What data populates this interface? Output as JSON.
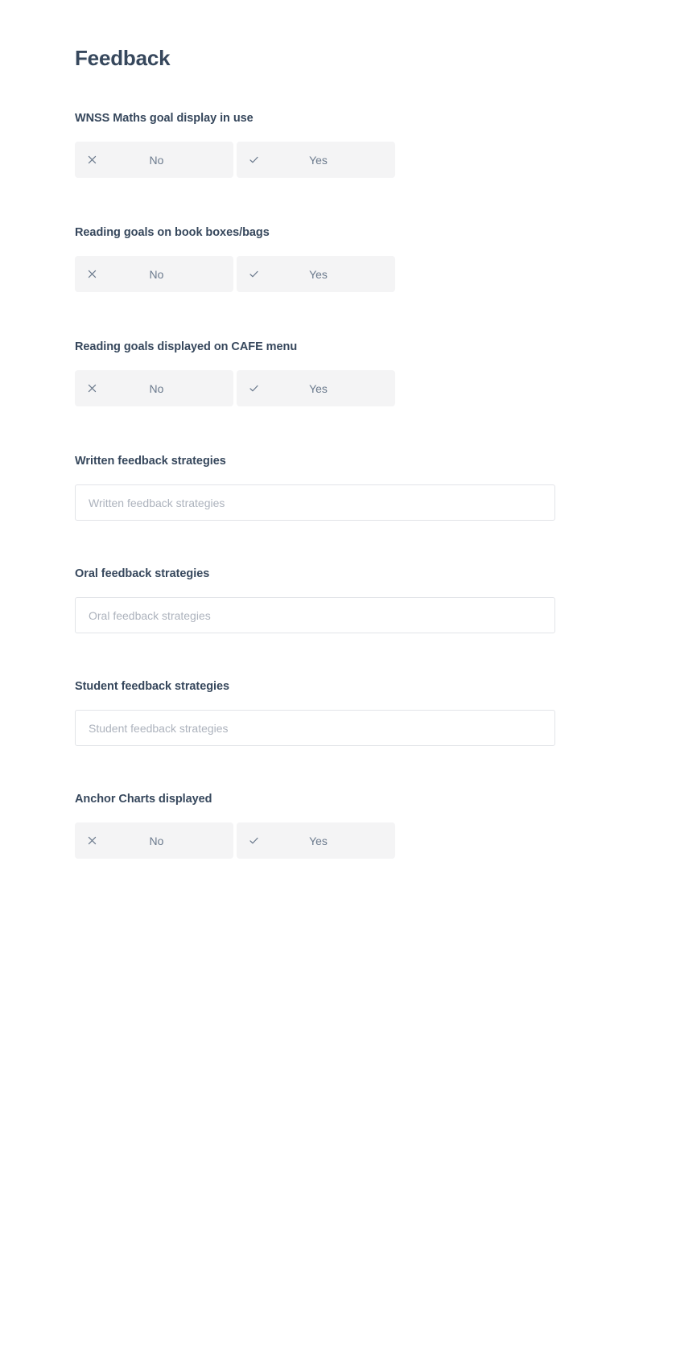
{
  "page": {
    "title": "Feedback",
    "background_color": "#ffffff",
    "heading_color": "#36475c",
    "toggle_background_color": "#f4f4f5",
    "toggle_text_color": "#6b7a8d",
    "input_border_color": "#e2e4e8",
    "placeholder_color": "#adb3bd"
  },
  "fields": [
    {
      "type": "toggle",
      "label": "WNSS Maths goal display in use",
      "name": "wnss-maths-goal-display-in-use",
      "options": [
        {
          "label": "No",
          "icon": "close-icon"
        },
        {
          "label": "Yes",
          "icon": "check-icon"
        }
      ]
    },
    {
      "type": "toggle",
      "label": "Reading goals on book boxes/bags",
      "name": "reading-goals-on-book-boxes-bags",
      "options": [
        {
          "label": "No",
          "icon": "close-icon"
        },
        {
          "label": "Yes",
          "icon": "check-icon"
        }
      ]
    },
    {
      "type": "toggle",
      "label": "Reading goals displayed on CAFE menu",
      "name": "reading-goals-displayed-on-cafe-menu",
      "options": [
        {
          "label": "No",
          "icon": "close-icon"
        },
        {
          "label": "Yes",
          "icon": "check-icon"
        }
      ]
    },
    {
      "type": "text",
      "label": "Written feedback strategies",
      "name": "written-feedback-strategies",
      "placeholder": "Written feedback strategies",
      "value": ""
    },
    {
      "type": "text",
      "label": "Oral feedback strategies",
      "name": "oral-feedback-strategies",
      "placeholder": "Oral feedback strategies",
      "value": ""
    },
    {
      "type": "text",
      "label": "Student feedback strategies",
      "name": "student-feedback-strategies",
      "placeholder": "Student feedback strategies",
      "value": ""
    },
    {
      "type": "toggle",
      "label": "Anchor Charts displayed",
      "name": "anchor-charts-displayed",
      "options": [
        {
          "label": "No",
          "icon": "close-icon"
        },
        {
          "label": "Yes",
          "icon": "check-icon"
        }
      ]
    }
  ]
}
